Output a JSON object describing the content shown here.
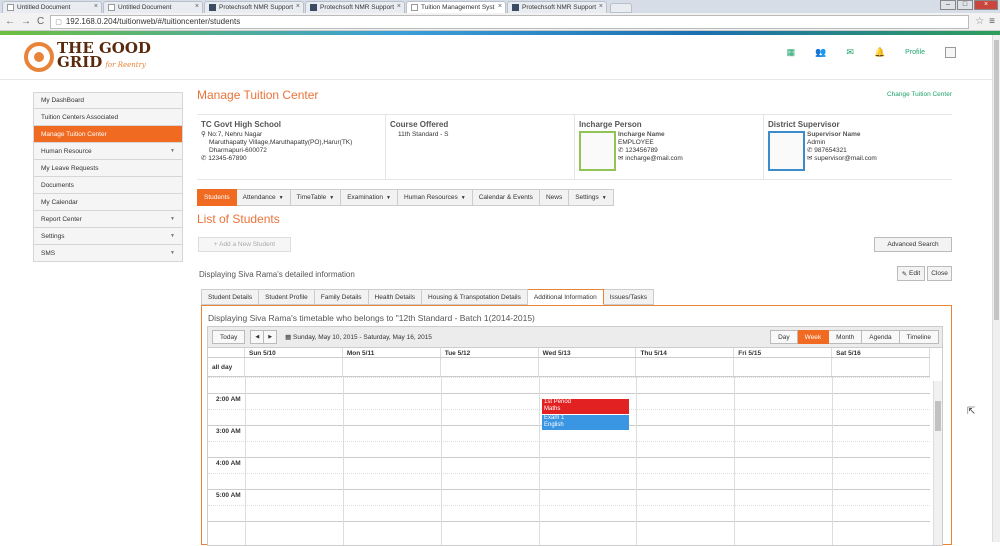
{
  "browser": {
    "tabs": [
      {
        "title": "Untitled Document",
        "icon": "doc"
      },
      {
        "title": "Untitled Document",
        "icon": "doc"
      },
      {
        "title": "Protechsoft NMR Support",
        "icon": "pf"
      },
      {
        "title": "Protechsoft NMR Support",
        "icon": "pf"
      },
      {
        "title": "Tuition Management Syst",
        "icon": "doc"
      },
      {
        "title": "Protechsoft NMR Support",
        "icon": "pf"
      }
    ],
    "url": "192.168.0.204/tuitionweb/#/tuitioncenter/students"
  },
  "header": {
    "logo_line1": "THE GOOD",
    "logo_line2": "GRID",
    "logo_sub": "for Reentry",
    "profile_label": "Profile"
  },
  "sidebar": {
    "items": [
      {
        "label": "My DashBoard",
        "caret": ""
      },
      {
        "label": "Tuition Centers Associated",
        "caret": ""
      },
      {
        "label": "Manage Tuition Center",
        "caret": ""
      },
      {
        "label": "Human Resource",
        "caret": "▼"
      },
      {
        "label": "My Leave Requests",
        "caret": ""
      },
      {
        "label": "Documents",
        "caret": ""
      },
      {
        "label": "My Calendar",
        "caret": ""
      },
      {
        "label": "Report Center",
        "caret": "▼"
      },
      {
        "label": "Settings",
        "caret": "▼"
      },
      {
        "label": "SMS",
        "caret": "▼"
      }
    ]
  },
  "main": {
    "title": "Manage Tuition Center",
    "change_link": "Change Tuition Center",
    "school": {
      "name": "TC Govt High School",
      "address1": "No:7, Nehru Nagar",
      "address2": "Maruthapatty Village,Maruthapatty(PO),Harur(TK)",
      "address3": "Dharmapuri-600072",
      "phone": "12345-67890"
    },
    "course": {
      "heading": "Course Offered",
      "value": "11th Standard - S"
    },
    "incharge": {
      "heading": "Incharge Person",
      "name_label": "Incharge Name",
      "role": "EMPLOYEE",
      "phone": "123456789",
      "email": "incharge@mail.com"
    },
    "supervisor": {
      "heading": "District Supervisor",
      "name_label": "Supervisor Name",
      "role": "Admin",
      "phone": "987654321",
      "email": "supervisor@mail.com"
    },
    "tabs": [
      {
        "label": "Students",
        "caret": ""
      },
      {
        "label": "Attendance",
        "caret": "▼"
      },
      {
        "label": "TimeTable",
        "caret": "▼"
      },
      {
        "label": "Examination",
        "caret": "▼"
      },
      {
        "label": "Human Resources",
        "caret": "▼"
      },
      {
        "label": "Calendar & Events",
        "caret": ""
      },
      {
        "label": "News",
        "caret": ""
      },
      {
        "label": "Settings",
        "caret": "▼"
      }
    ],
    "list_title": "List of Students",
    "add_button": "+ Add a New Student",
    "advanced_search": "Advanced Search",
    "displaying": "Displaying Siva Rama's detailed information",
    "edit": "Edit",
    "close": "Close"
  },
  "student_tabs": [
    "Student Details",
    "Student Profile",
    "Family Details",
    "Health Details",
    "Housing & Transpotation Details",
    "Additional Information",
    "Issues/Tasks"
  ],
  "timetable": {
    "title": "Displaying Siva Rama's timetable who belongs to \"12th Standard - Batch 1(2014-2015)",
    "today": "Today",
    "range": "Sunday, May 10, 2015 - Saturday, May 16, 2015",
    "views": [
      "Day",
      "Week",
      "Month",
      "Agenda",
      "Timeline"
    ],
    "active_view": "Week",
    "days": [
      "Sun 5/10",
      "Mon 5/11",
      "Tue 5/12",
      "Wed 5/13",
      "Thu 5/14",
      "Fri 5/15",
      "Sat 5/16"
    ],
    "allday_label": "all day",
    "times": [
      "2:00 AM",
      "3:00 AM",
      "4:00 AM",
      "5:00 AM"
    ],
    "events": [
      {
        "title": "1st Period",
        "subject": "Maths",
        "color": "#e12122"
      },
      {
        "title": "Exam 1",
        "subject": "English",
        "color": "#3a95e3"
      }
    ]
  },
  "colors": {
    "accent": "#f06a22",
    "green": "#1ea36b"
  }
}
